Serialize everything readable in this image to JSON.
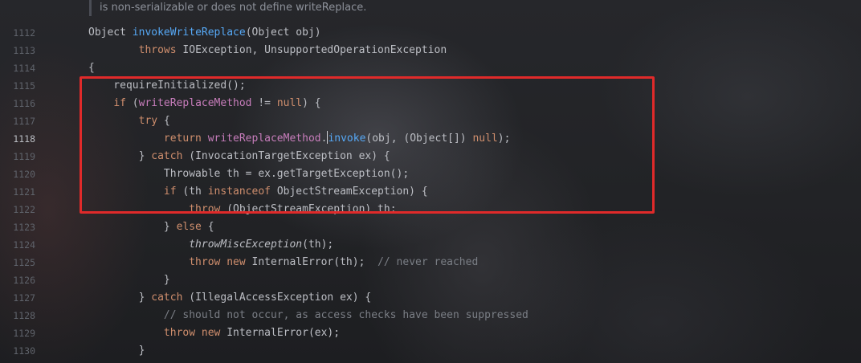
{
  "doc_comment": "is non-serializable or does not define writeReplace.",
  "current_line": "1118",
  "line_numbers": [
    "1112",
    "1113",
    "1114",
    "1115",
    "1116",
    "1117",
    "1118",
    "1119",
    "1120",
    "1121",
    "1122",
    "1123",
    "1124",
    "1125",
    "1126",
    "1127",
    "1128",
    "1129",
    "1130"
  ],
  "code_lines": [
    [
      {
        "t": "Object ",
        "c": "plain"
      },
      {
        "t": "invokeWriteReplace",
        "c": "fn"
      },
      {
        "t": "(Object obj)",
        "c": "plain"
      }
    ],
    [
      {
        "t": "        ",
        "c": "plain"
      },
      {
        "t": "throws ",
        "c": "kw"
      },
      {
        "t": "IOException, UnsupportedOperationException",
        "c": "plain"
      }
    ],
    [
      {
        "t": "{",
        "c": "plain"
      }
    ],
    [
      {
        "t": "    requireInitialized();",
        "c": "plain"
      }
    ],
    [
      {
        "t": "    ",
        "c": "plain"
      },
      {
        "t": "if ",
        "c": "kw"
      },
      {
        "t": "(",
        "c": "plain"
      },
      {
        "t": "writeReplaceMethod",
        "c": "field"
      },
      {
        "t": " != ",
        "c": "plain"
      },
      {
        "t": "null",
        "c": "kw"
      },
      {
        "t": ") {",
        "c": "plain"
      }
    ],
    [
      {
        "t": "        ",
        "c": "plain"
      },
      {
        "t": "try ",
        "c": "kw"
      },
      {
        "t": "{",
        "c": "plain"
      }
    ],
    [
      {
        "t": "            ",
        "c": "plain"
      },
      {
        "t": "return ",
        "c": "kw"
      },
      {
        "t": "writeReplaceMethod",
        "c": "field"
      },
      {
        "t": ".",
        "c": "plain"
      },
      {
        "t": "|",
        "c": "caret"
      },
      {
        "t": "invoke",
        "c": "fn"
      },
      {
        "t": "(obj, (Object[]) ",
        "c": "plain"
      },
      {
        "t": "null",
        "c": "kw"
      },
      {
        "t": ");",
        "c": "plain"
      }
    ],
    [
      {
        "t": "        } ",
        "c": "plain"
      },
      {
        "t": "catch ",
        "c": "kw"
      },
      {
        "t": "(InvocationTargetException ex) {",
        "c": "plain"
      }
    ],
    [
      {
        "t": "            Throwable th = ex.getTargetException();",
        "c": "plain"
      }
    ],
    [
      {
        "t": "            ",
        "c": "plain"
      },
      {
        "t": "if ",
        "c": "kw"
      },
      {
        "t": "(th ",
        "c": "plain"
      },
      {
        "t": "instanceof ",
        "c": "kw"
      },
      {
        "t": "ObjectStreamException) {",
        "c": "plain"
      }
    ],
    [
      {
        "t": "                ",
        "c": "plain"
      },
      {
        "t": "throw ",
        "c": "kw"
      },
      {
        "t": "(ObjectStreamException) th;",
        "c": "plain"
      }
    ],
    [
      {
        "t": "            } ",
        "c": "plain"
      },
      {
        "t": "else ",
        "c": "kw"
      },
      {
        "t": "{",
        "c": "plain"
      }
    ],
    [
      {
        "t": "                ",
        "c": "plain"
      },
      {
        "t": "throwMiscException",
        "c": "ital"
      },
      {
        "t": "(th);",
        "c": "plain"
      }
    ],
    [
      {
        "t": "                ",
        "c": "plain"
      },
      {
        "t": "throw new ",
        "c": "kw"
      },
      {
        "t": "InternalError(th);  ",
        "c": "plain"
      },
      {
        "t": "// never reached",
        "c": "comment"
      }
    ],
    [
      {
        "t": "            }",
        "c": "plain"
      }
    ],
    [
      {
        "t": "        } ",
        "c": "plain"
      },
      {
        "t": "catch ",
        "c": "kw"
      },
      {
        "t": "(IllegalAccessException ex) {",
        "c": "plain"
      }
    ],
    [
      {
        "t": "            ",
        "c": "plain"
      },
      {
        "t": "// should not occur, as access checks have been suppressed",
        "c": "comment"
      }
    ],
    [
      {
        "t": "            ",
        "c": "plain"
      },
      {
        "t": "throw new ",
        "c": "kw"
      },
      {
        "t": "InternalError(ex);",
        "c": "plain"
      }
    ],
    [
      {
        "t": "        }",
        "c": "plain"
      }
    ]
  ],
  "colors": {
    "keyword": "#cf8e6d",
    "method": "#56a8f5",
    "field": "#c77dbb",
    "comment": "#7a7e85",
    "plain": "#bcbec4",
    "highlight_box": "#e02a2a"
  }
}
